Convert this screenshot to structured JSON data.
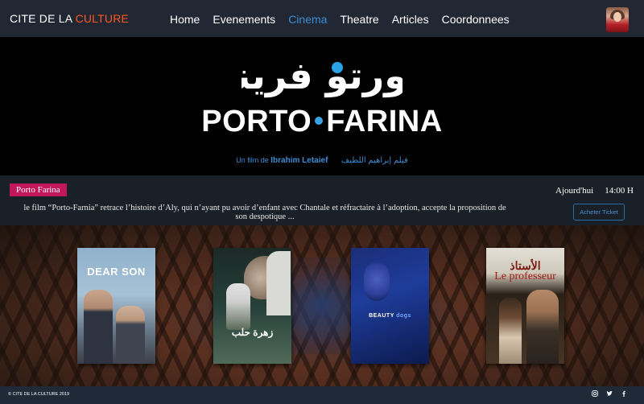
{
  "navbar": {
    "brand_part1": "CITE DE LA ",
    "brand_part2": "CULTURE",
    "links": [
      "Home",
      "Evenements",
      "Cinema",
      "Theatre",
      "Articles",
      "Coordonnees"
    ],
    "active_link": "Cinema",
    "active_color": "#3c8dd6",
    "brand_accent_color": "#ff5722"
  },
  "hero": {
    "logo_arabic": "بورتو فرينا",
    "title_left": "PORTO",
    "title_right": "FARINA",
    "credit_prefix": "Un film de",
    "credit_director": "Ibrahim Letaief",
    "credit_arabic": "فيلم إبراهيم اللطيف"
  },
  "movie": {
    "tag": "Porto Farina",
    "synopsis": "le film “Porto-Farnia” retrace l’histoire d’Aly, qui n’ayant pu avoir d’enfant avec Chantale et réfractaire à l’adoption, accepte la proposition de son despotique ...",
    "day": "Ajourd'hui",
    "time": "14:00 H",
    "ticket_button": "Acheter Ticket"
  },
  "posters": [
    {
      "title": "DEAR SON",
      "icon": "poster-dear-son"
    },
    {
      "title": "زهرة حلب",
      "icon": "poster-zahret-halab"
    },
    {
      "title_a": "BEAUTY",
      "title_b": "dogs",
      "icon": "poster-beauty-and-the-dogs"
    },
    {
      "title_ar": "الأستاذ",
      "title": "Le professeur",
      "icon": "poster-le-professeur"
    }
  ],
  "footer": {
    "copyright": "© CITE DE LA CULTURE 2019",
    "social": [
      "instagram-icon",
      "twitter-icon",
      "facebook-icon"
    ]
  }
}
